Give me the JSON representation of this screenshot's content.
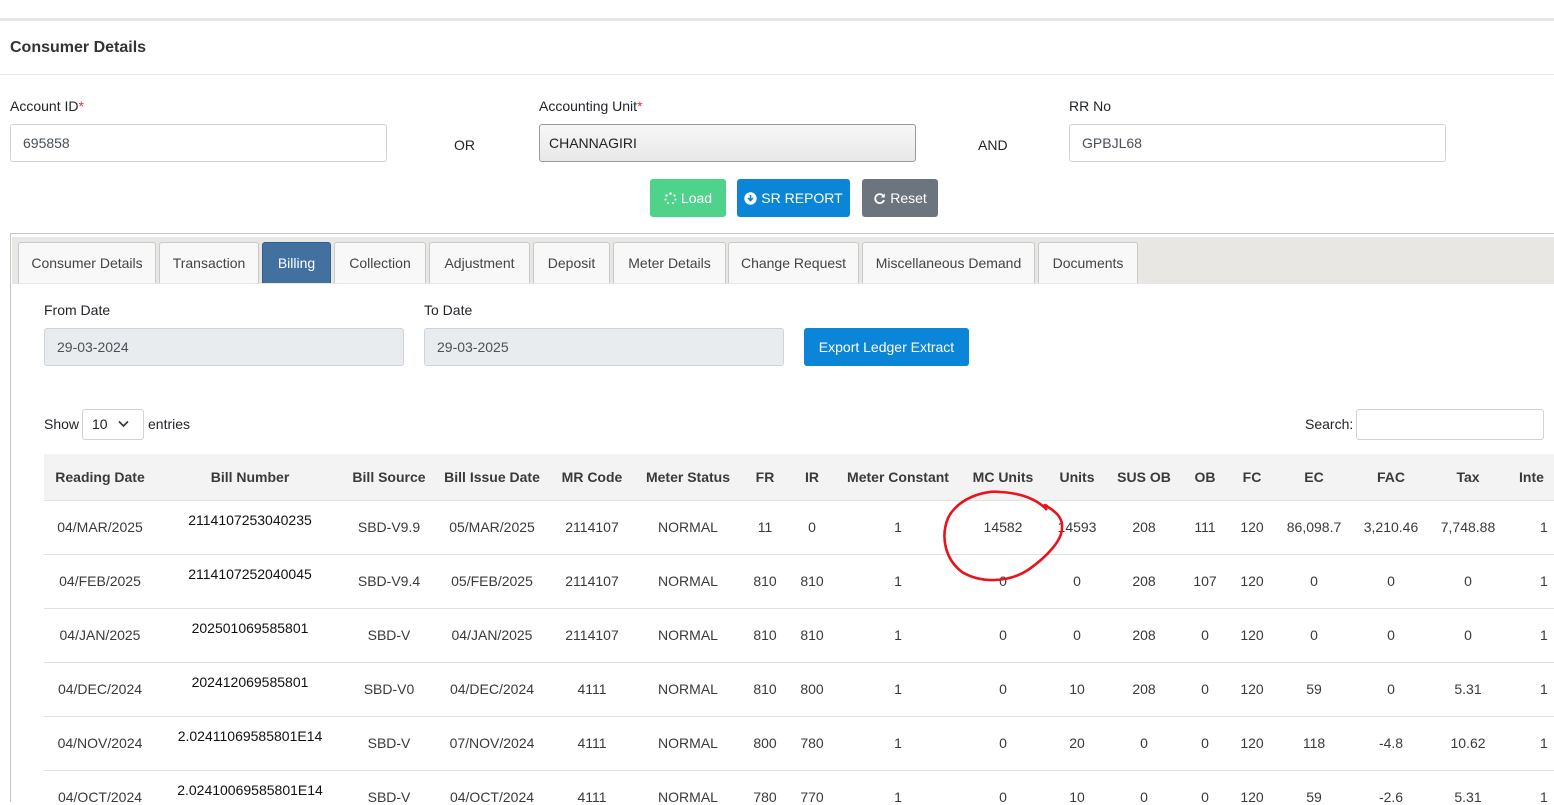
{
  "page": {
    "title": "Consumer Details"
  },
  "search_form": {
    "account_id_label": "Account ID",
    "account_id_value": "695858",
    "or_label": "OR",
    "accounting_unit_label": "Accounting Unit",
    "accounting_unit_value": "CHANNAGIRI",
    "and_label": "AND",
    "rr_no_label": "RR No",
    "rr_no_value": "GPBJL68",
    "required_mark": "*"
  },
  "actions": {
    "load_label": "Load",
    "sr_report_label": "SR REPORT",
    "reset_label": "Reset"
  },
  "tabs": [
    {
      "label": "Consumer Details"
    },
    {
      "label": "Transaction"
    },
    {
      "label": "Billing",
      "active": true
    },
    {
      "label": "Collection"
    },
    {
      "label": "Adjustment"
    },
    {
      "label": "Deposit"
    },
    {
      "label": "Meter Details"
    },
    {
      "label": "Change Request"
    },
    {
      "label": "Miscellaneous Demand"
    },
    {
      "label": "Documents"
    }
  ],
  "billing": {
    "from_date_label": "From Date",
    "from_date_value": "29-03-2024",
    "to_date_label": "To Date",
    "to_date_value": "29-03-2025",
    "export_label": "Export Ledger Extract",
    "show_label": "Show",
    "entries_label": "entries",
    "page_length": "10",
    "search_label": "Search:",
    "columns": [
      "Reading Date",
      "Bill Number",
      "Bill Source",
      "Bill Issue Date",
      "MR Code",
      "Meter Status",
      "FR",
      "IR",
      "Meter Constant",
      "MC Units",
      "Units",
      "SUS OB",
      "OB",
      "FC",
      "EC",
      "FAC",
      "Tax",
      "Inte"
    ],
    "rows": [
      [
        "04/MAR/2025",
        "2114107253040235",
        "SBD-V9.9",
        "05/MAR/2025",
        "2114107",
        "NORMAL",
        "11",
        "0",
        "1",
        "14582",
        "14593",
        "208",
        "111",
        "120",
        "86,098.7",
        "3,210.46",
        "7,748.88",
        "1"
      ],
      [
        "04/FEB/2025",
        "2114107252040045",
        "SBD-V9.4",
        "05/FEB/2025",
        "2114107",
        "NORMAL",
        "810",
        "810",
        "1",
        "0",
        "0",
        "208",
        "107",
        "120",
        "0",
        "0",
        "0",
        "1"
      ],
      [
        "04/JAN/2025",
        "202501069585801",
        "SBD-V",
        "04/JAN/2025",
        "2114107",
        "NORMAL",
        "810",
        "810",
        "1",
        "0",
        "0",
        "208",
        "0",
        "120",
        "0",
        "0",
        "0",
        "1"
      ],
      [
        "04/DEC/2024",
        "202412069585801",
        "SBD-V0",
        "04/DEC/2024",
        "4111",
        "NORMAL",
        "810",
        "800",
        "1",
        "0",
        "10",
        "208",
        "0",
        "120",
        "59",
        "0",
        "5.31",
        "1"
      ],
      [
        "04/NOV/2024",
        "2.02411069585801E14",
        "SBD-V",
        "07/NOV/2024",
        "4111",
        "NORMAL",
        "800",
        "780",
        "1",
        "0",
        "20",
        "0",
        "0",
        "120",
        "118",
        "-4.8",
        "10.62",
        "1"
      ],
      [
        "04/OCT/2024",
        "2.02410069585801E14",
        "SBD-V",
        "04/OCT/2024",
        "4111",
        "NORMAL",
        "780",
        "770",
        "1",
        "0",
        "10",
        "0",
        "0",
        "120",
        "59",
        "-2.6",
        "5.31",
        "1"
      ]
    ]
  },
  "annotation": {
    "color": "#e8141c"
  }
}
